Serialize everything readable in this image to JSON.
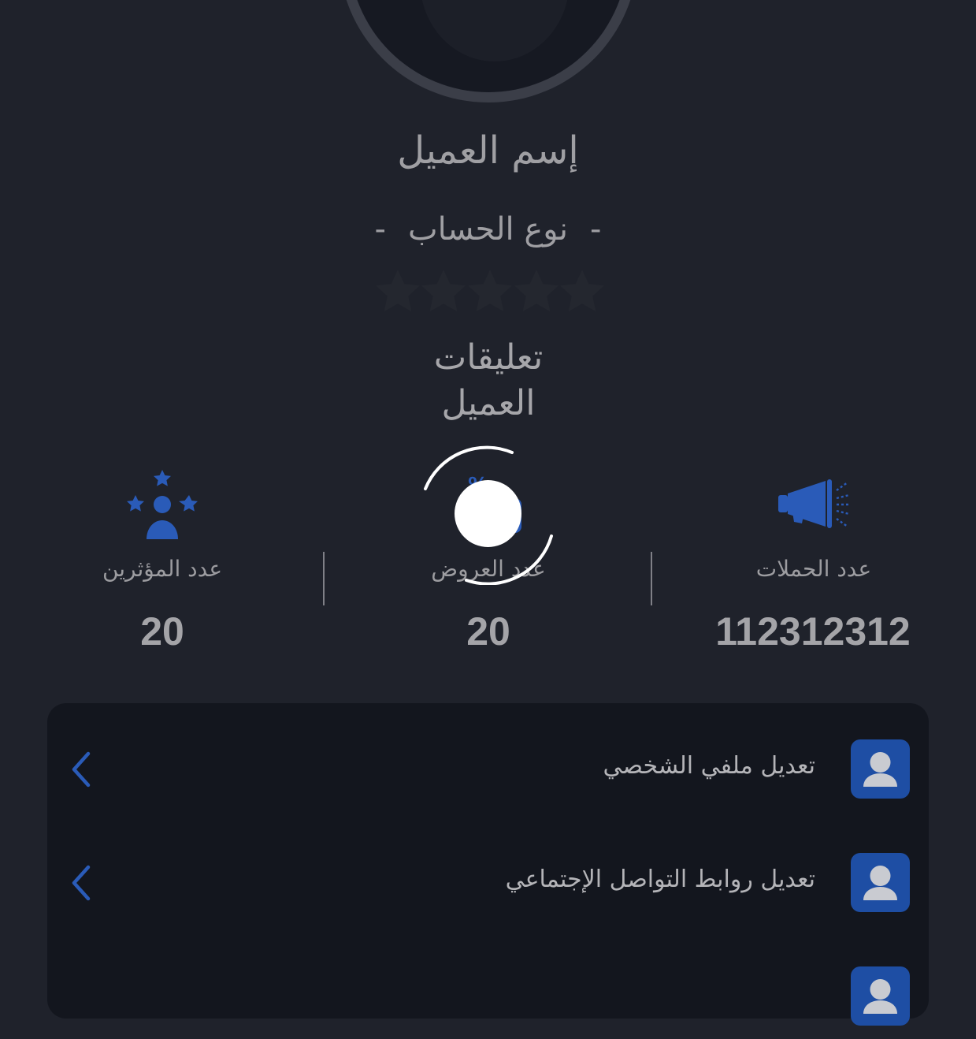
{
  "profile": {
    "name": "إسم العميل",
    "account_type": "نوع الحساب",
    "account_type_dash": "-",
    "rating": 0,
    "rating_max": 5,
    "comments_line1": "تعليقات",
    "comments_line2": "العميل"
  },
  "stats": [
    {
      "label": "عدد الحملات",
      "value": "112312312",
      "icon": "megaphone-icon"
    },
    {
      "label": "عدد العروض",
      "value": "20",
      "icon": "offers-icon"
    },
    {
      "label": "عدد المؤثرين",
      "value": "20",
      "icon": "influencers-icon"
    }
  ],
  "menu": [
    {
      "label": "تعديل ملفي الشخصي",
      "icon": "user-icon"
    },
    {
      "label": "تعديل روابط التواصل الإجتماعي",
      "icon": "user-icon"
    },
    {
      "label": "",
      "icon": "user-icon"
    }
  ],
  "colors": {
    "background": "#1f222b",
    "card": "#13161e",
    "accent": "#1e4ea4",
    "icon_blue": "#2a5bb8",
    "text": "#a9a9ad"
  }
}
